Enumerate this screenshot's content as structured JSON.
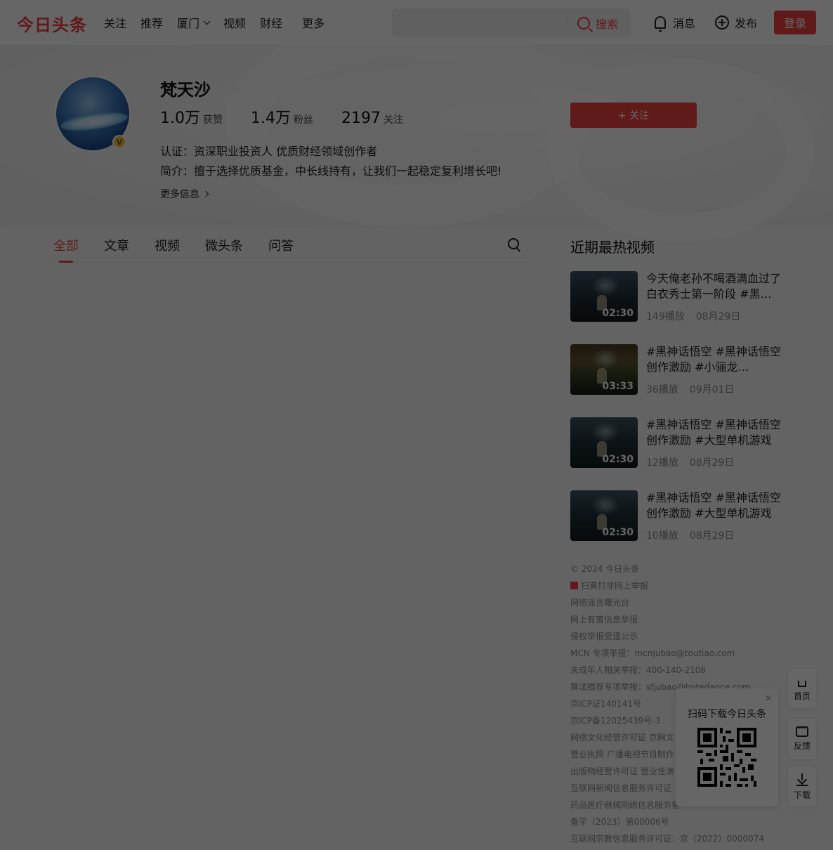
{
  "header": {
    "logo": "今日头条",
    "nav": [
      "关注",
      "推荐",
      "厦门",
      "视频",
      "财经",
      "更多"
    ],
    "search": {
      "placeholder": "",
      "button": "搜索"
    },
    "messages": "消息",
    "publish": "发布",
    "login": "登录"
  },
  "profile": {
    "name": "梵天沙",
    "badge": "V",
    "stats": [
      {
        "num": "1.0万",
        "label": "获赞"
      },
      {
        "num": "1.4万",
        "label": "粉丝"
      },
      {
        "num": "2197",
        "label": "关注"
      }
    ],
    "follow": "+ 关注",
    "certification": "认证：资深职业投资人 优质财经领域创作者",
    "intro": "简介：擅于选择优质基金，中长线持有，让我们一起稳定复利增长吧!",
    "more": "更多信息"
  },
  "tabs": [
    "全部",
    "文章",
    "视频",
    "微头条",
    "问答"
  ],
  "hot_videos": {
    "title": "近期最热视频",
    "items": [
      {
        "title": "今天俺老孙不喝酒满血过了白衣秀士第一阶段 #黑神话悟空",
        "duration": "02:30",
        "plays": "149播放",
        "date": "08月29日"
      },
      {
        "title": "#黑神话悟空 #黑神话悟空创作激励 #小骊龙 #steam",
        "duration": "03:33",
        "plays": "36播放",
        "date": "09月01日"
      },
      {
        "title": "#黑神话悟空 #黑神话悟空创作激励 #大型单机游戏",
        "duration": "02:30",
        "plays": "12播放",
        "date": "08月29日"
      },
      {
        "title": "#黑神话悟空 #黑神话悟空创作激励 #大型单机游戏",
        "duration": "02:30",
        "plays": "10播放",
        "date": "08月29日"
      }
    ]
  },
  "footer": [
    "© 2024 今日头条",
    "扫黄打非网上举报",
    "网络谣言曝光台",
    "网上有害信息举报",
    "侵权举报受理公示",
    "MCN 专项举报：mcnjubao@toutiao.com",
    "未成年人相关举报：400-140-2108",
    "算法推荐专项举报：sfjubao@bytedance.com",
    "京ICP证140141号",
    "京ICP备12025439号-3",
    "网络文化经营许可证 京网文",
    "营业执照 广播电视节目制作",
    "出版物经营许可证 营业性演",
    "互联网新闻信息服务许可证",
    "药品医疗器械网络信息服务备",
    "备字（2023）第00006号",
    "互联网宗教信息服务许可证：京（2022）0000074"
  ],
  "qr_popup": {
    "close": "×",
    "title": "扫码下载今日头条"
  },
  "side_buttons": [
    "首页",
    "反馈",
    "下载"
  ]
}
